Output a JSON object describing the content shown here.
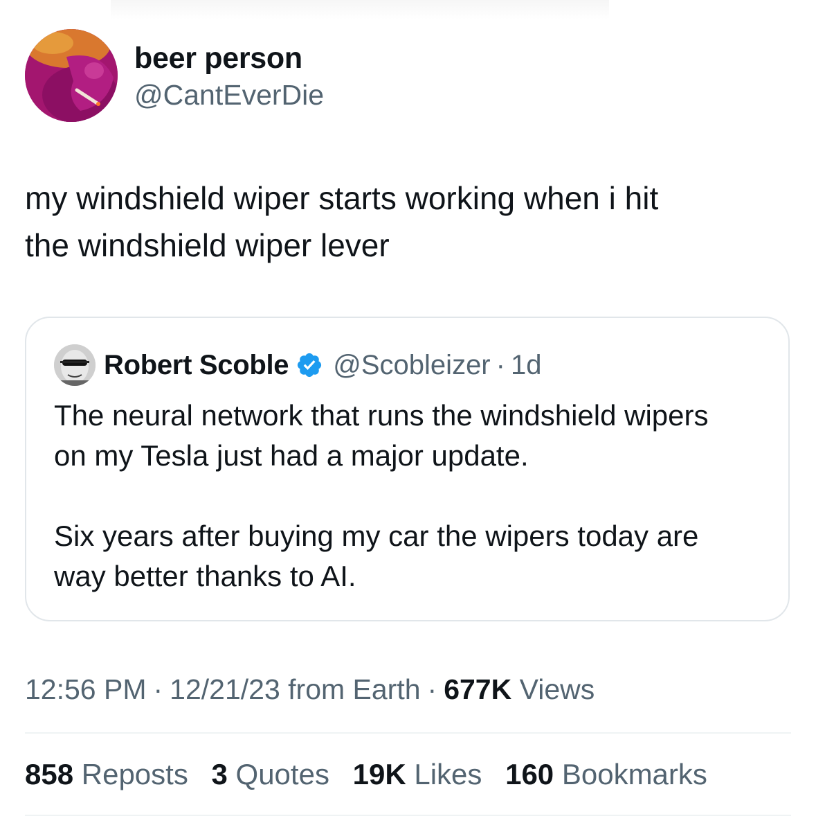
{
  "author": {
    "display_name": "beer person",
    "handle": "@CantEverDie",
    "avatar_icon": "purple-cartoon-smoking-avatar"
  },
  "tweet": {
    "text_line1": "my windshield wiper starts working when i hit",
    "text_line2": "the windshield wiper lever"
  },
  "quoted_tweet": {
    "display_name": "Robert Scoble",
    "verified_icon": "verified-badge-icon",
    "handle": "@Scobleizer",
    "separator": "·",
    "time": "1d",
    "paragraph1_line1": "The neural network that runs the windshield wipers",
    "paragraph1_line2": "on my Tesla just had a major update.",
    "paragraph2_line1": "Six years after buying my car the wipers today are",
    "paragraph2_line2": "way better thanks to AI."
  },
  "meta": {
    "time": "12:56 PM",
    "separator": "·",
    "date": "12/21/23 from Earth",
    "views_count": "677K",
    "views_label": "Views"
  },
  "stats": {
    "reposts_count": "858",
    "reposts_label": "Reposts",
    "quotes_count": "3",
    "quotes_label": "Quotes",
    "likes_count": "19K",
    "likes_label": "Likes",
    "bookmarks_count": "160",
    "bookmarks_label": "Bookmarks"
  },
  "colors": {
    "text_primary": "#0f1419",
    "text_secondary": "#536471",
    "verified_blue": "#1d9bf0",
    "border": "#e1e6ea"
  }
}
